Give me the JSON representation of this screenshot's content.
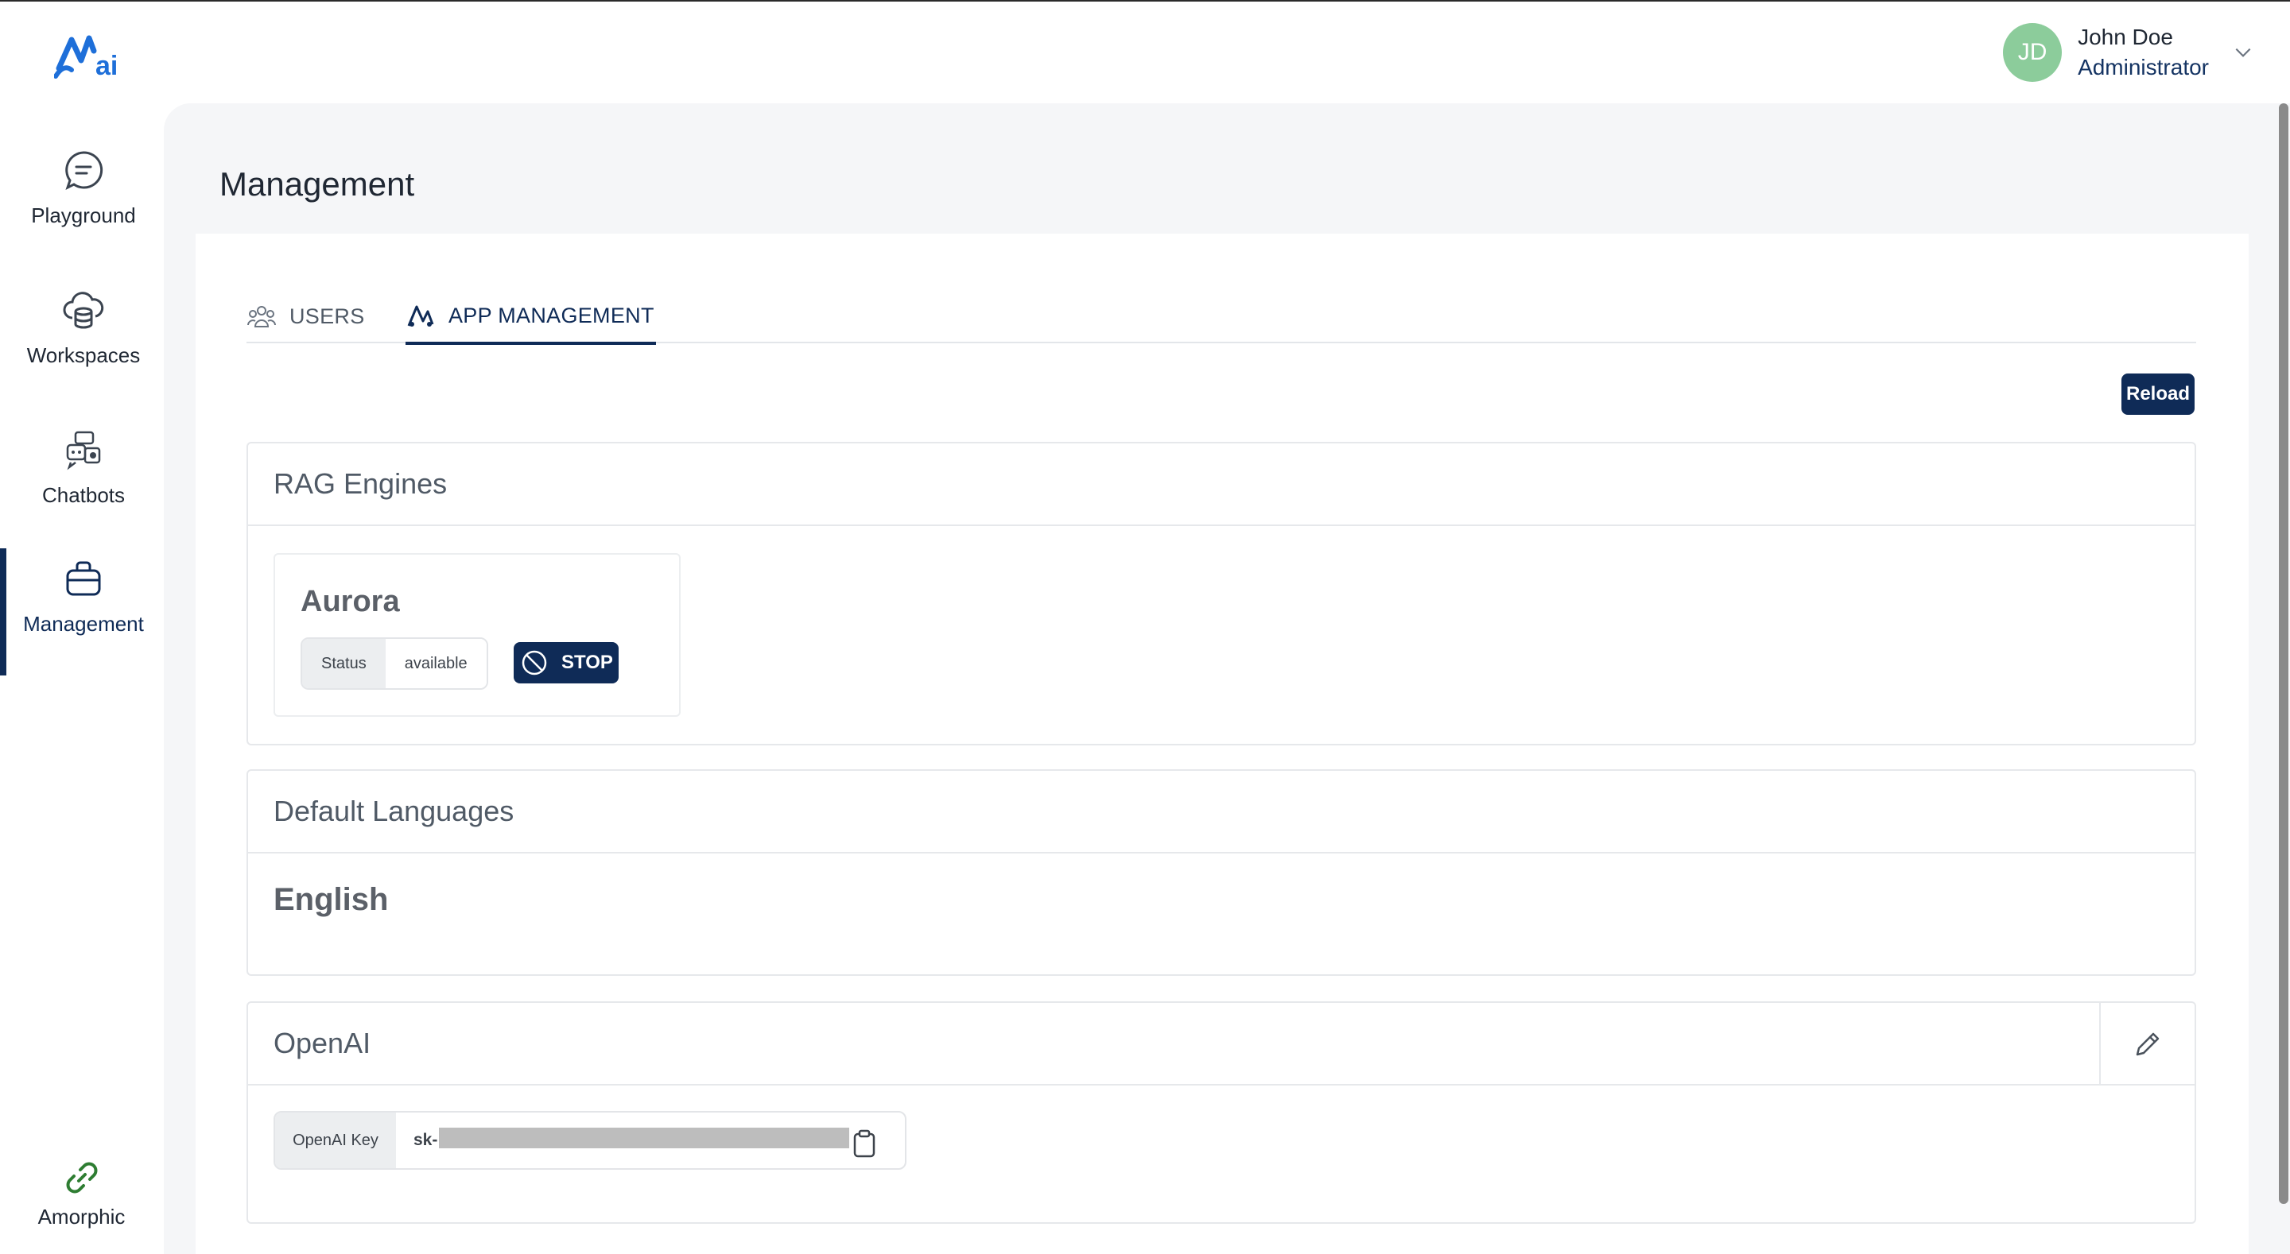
{
  "brand": {
    "logo_icon": "amorphic-ai-logo"
  },
  "user": {
    "initials": "JD",
    "name": "John Doe",
    "role": "Administrator",
    "menu_icon": "chevron-down-icon"
  },
  "sidebar": {
    "items": [
      {
        "label": "Playground",
        "icon": "chat-bubble-icon"
      },
      {
        "label": "Workspaces",
        "icon": "cloud-database-icon"
      },
      {
        "label": "Chatbots",
        "icon": "chatbot-icon"
      },
      {
        "label": "Management",
        "icon": "briefcase-icon",
        "active": true
      }
    ],
    "footer": {
      "label": "Amorphic",
      "icon": "link-icon"
    }
  },
  "page": {
    "title": "Management"
  },
  "tabs": [
    {
      "label": "USERS",
      "icon": "users-icon",
      "active": false
    },
    {
      "label": "APP MANAGEMENT",
      "icon": "app-icon",
      "active": true
    }
  ],
  "toolbar": {
    "reload_label": "Reload"
  },
  "rag": {
    "title": "RAG Engines",
    "engines": [
      {
        "name": "Aurora",
        "status_key": "Status",
        "status_value": "available",
        "action_label": "STOP",
        "action_icon": "ban-icon"
      }
    ]
  },
  "languages": {
    "title": "Default Languages",
    "default": "English"
  },
  "openai": {
    "title": "OpenAI",
    "edit_icon": "pencil-icon",
    "key_label": "OpenAI Key",
    "key_prefix": "sk-",
    "copy_icon": "clipboard-icon"
  },
  "colors": {
    "primary": "#0f2b57",
    "avatar": "#8ccc9b",
    "panel_bg": "#f5f6f8",
    "logo_blue": "#1e6fd9",
    "link_green": "#2e7d32"
  }
}
